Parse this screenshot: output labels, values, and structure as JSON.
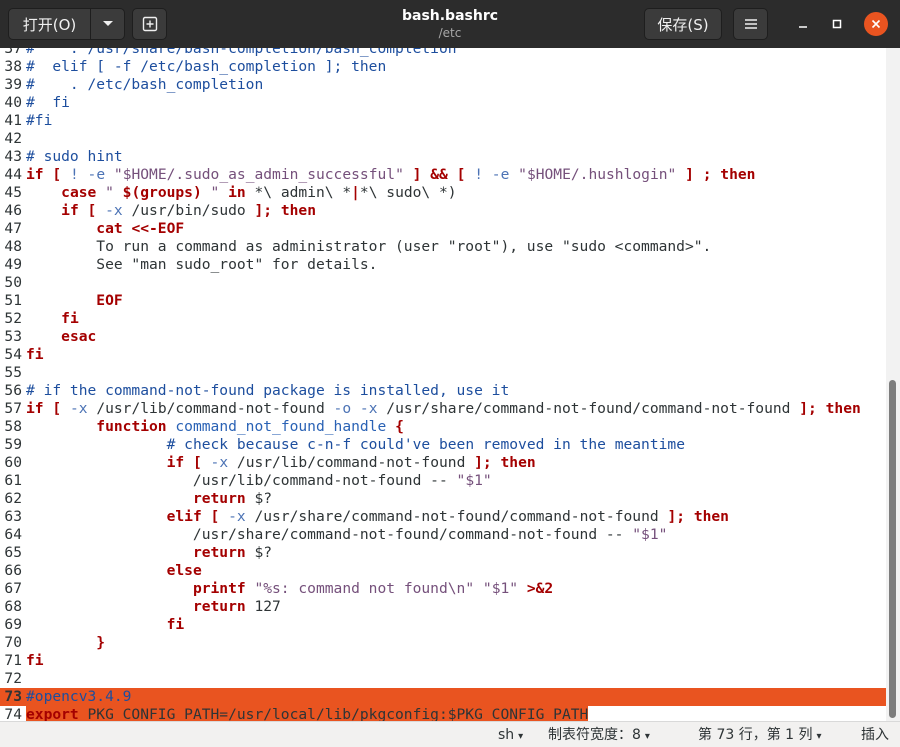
{
  "header": {
    "open_label": "打开(O)",
    "open_dropdown_icon": "chevron-down-icon",
    "new_tab_icon": "new-tab-icon",
    "title": "bash.bashrc",
    "subtitle": "/etc",
    "save_label": "保存(S)",
    "menu_icon": "hamburger-menu-icon",
    "window_controls": [
      "minimize-icon",
      "maximize-icon",
      "close-icon"
    ]
  },
  "editor": {
    "lines": [
      {
        "n": "37",
        "segs": [
          {
            "t": "#    . /usr/share/bash-completion/bash_completion",
            "c": "cmt"
          }
        ]
      },
      {
        "n": "38",
        "segs": [
          {
            "t": "#  elif [ -f /etc/bash_completion ]; then",
            "c": "cmt"
          }
        ]
      },
      {
        "n": "39",
        "segs": [
          {
            "t": "#    . /etc/bash_completion",
            "c": "cmt"
          }
        ]
      },
      {
        "n": "40",
        "segs": [
          {
            "t": "#  fi",
            "c": "cmt"
          }
        ]
      },
      {
        "n": "41",
        "segs": [
          {
            "t": "#fi",
            "c": "cmt"
          }
        ]
      },
      {
        "n": "42",
        "segs": []
      },
      {
        "n": "43",
        "segs": [
          {
            "t": "# sudo hint",
            "c": "cmt"
          }
        ]
      },
      {
        "n": "44",
        "segs": [
          {
            "t": "if",
            "c": "kw"
          },
          {
            "t": " ",
            "c": ""
          },
          {
            "t": "[",
            "c": "kw"
          },
          {
            "t": " ! -e ",
            "c": "opt"
          },
          {
            "t": "\"",
            "c": "str"
          },
          {
            "t": "$HOME",
            "c": "var"
          },
          {
            "t": "/.sudo_as_admin_successful\"",
            "c": "str"
          },
          {
            "t": " ",
            "c": ""
          },
          {
            "t": "]",
            "c": "kw"
          },
          {
            "t": " ",
            "c": ""
          },
          {
            "t": "&&",
            "c": "kw"
          },
          {
            "t": " ",
            "c": ""
          },
          {
            "t": "[",
            "c": "kw"
          },
          {
            "t": " ! -e ",
            "c": "opt"
          },
          {
            "t": "\"",
            "c": "str"
          },
          {
            "t": "$HOME",
            "c": "var"
          },
          {
            "t": "/.hushlogin\"",
            "c": "str"
          },
          {
            "t": " ",
            "c": ""
          },
          {
            "t": "]",
            "c": "kw"
          },
          {
            "t": " ",
            "c": ""
          },
          {
            "t": ";",
            "c": "kw"
          },
          {
            "t": " ",
            "c": ""
          },
          {
            "t": "then",
            "c": "kw"
          }
        ]
      },
      {
        "n": "45",
        "segs": [
          {
            "t": "    ",
            "c": ""
          },
          {
            "t": "case",
            "c": "kw"
          },
          {
            "t": " \" ",
            "c": "str"
          },
          {
            "t": "$(groups)",
            "c": "kw"
          },
          {
            "t": " \" ",
            "c": "str"
          },
          {
            "t": "in",
            "c": "kw"
          },
          {
            "t": " *\\ admin\\ *",
            "c": ""
          },
          {
            "t": "|",
            "c": "kw"
          },
          {
            "t": "*\\ sudo\\ *)",
            "c": ""
          }
        ]
      },
      {
        "n": "46",
        "segs": [
          {
            "t": "    ",
            "c": ""
          },
          {
            "t": "if",
            "c": "kw"
          },
          {
            "t": " ",
            "c": ""
          },
          {
            "t": "[",
            "c": "kw"
          },
          {
            "t": " -x",
            "c": "opt"
          },
          {
            "t": " /usr/bin/sudo ",
            "c": ""
          },
          {
            "t": "];",
            "c": "kw"
          },
          {
            "t": " ",
            "c": ""
          },
          {
            "t": "then",
            "c": "kw"
          }
        ]
      },
      {
        "n": "47",
        "segs": [
          {
            "t": "        ",
            "c": ""
          },
          {
            "t": "cat <<-EOF",
            "c": "kw"
          }
        ]
      },
      {
        "n": "48",
        "segs": [
          {
            "t": "        To run a command as administrator (user \"root\"), use \"sudo <command>\".",
            "c": ""
          }
        ]
      },
      {
        "n": "49",
        "segs": [
          {
            "t": "        See \"man sudo_root\" for details.",
            "c": ""
          }
        ]
      },
      {
        "n": "50",
        "segs": []
      },
      {
        "n": "51",
        "segs": [
          {
            "t": "        ",
            "c": ""
          },
          {
            "t": "EOF",
            "c": "kw"
          }
        ]
      },
      {
        "n": "52",
        "segs": [
          {
            "t": "    ",
            "c": ""
          },
          {
            "t": "fi",
            "c": "kw"
          }
        ]
      },
      {
        "n": "53",
        "segs": [
          {
            "t": "    ",
            "c": ""
          },
          {
            "t": "esac",
            "c": "kw"
          }
        ]
      },
      {
        "n": "54",
        "segs": [
          {
            "t": "fi",
            "c": "kw"
          }
        ]
      },
      {
        "n": "55",
        "segs": []
      },
      {
        "n": "56",
        "segs": [
          {
            "t": "# if the command-not-found package is installed, use it",
            "c": "cmt"
          }
        ]
      },
      {
        "n": "57",
        "segs": [
          {
            "t": "if",
            "c": "kw"
          },
          {
            "t": " ",
            "c": ""
          },
          {
            "t": "[",
            "c": "kw"
          },
          {
            "t": " -x",
            "c": "opt"
          },
          {
            "t": " /usr/lib/command-not-found ",
            "c": ""
          },
          {
            "t": "-o",
            "c": "opt"
          },
          {
            "t": " ",
            "c": ""
          },
          {
            "t": "-x",
            "c": "opt"
          },
          {
            "t": " /usr/share/command-not-found/command-not-found ",
            "c": ""
          },
          {
            "t": "];",
            "c": "kw"
          },
          {
            "t": " ",
            "c": ""
          },
          {
            "t": "then",
            "c": "kw"
          }
        ]
      },
      {
        "n": "58",
        "segs": [
          {
            "t": "        ",
            "c": ""
          },
          {
            "t": "function",
            "c": "kw"
          },
          {
            "t": " ",
            "c": ""
          },
          {
            "t": "command_not_found_handle",
            "c": "fn"
          },
          {
            "t": " ",
            "c": ""
          },
          {
            "t": "{",
            "c": "kw"
          }
        ]
      },
      {
        "n": "59",
        "segs": [
          {
            "t": "                ",
            "c": ""
          },
          {
            "t": "# check because c-n-f could've been removed in the meantime",
            "c": "cmt"
          }
        ]
      },
      {
        "n": "60",
        "segs": [
          {
            "t": "                ",
            "c": ""
          },
          {
            "t": "if",
            "c": "kw"
          },
          {
            "t": " ",
            "c": ""
          },
          {
            "t": "[",
            "c": "kw"
          },
          {
            "t": " -x",
            "c": "opt"
          },
          {
            "t": " /usr/lib/command-not-found ",
            "c": ""
          },
          {
            "t": "];",
            "c": "kw"
          },
          {
            "t": " ",
            "c": ""
          },
          {
            "t": "then",
            "c": "kw"
          }
        ]
      },
      {
        "n": "61",
        "segs": [
          {
            "t": "                   /usr/lib/command-not-found -- ",
            "c": ""
          },
          {
            "t": "\"$1\"",
            "c": "str"
          }
        ]
      },
      {
        "n": "62",
        "segs": [
          {
            "t": "                   ",
            "c": ""
          },
          {
            "t": "return",
            "c": "kw"
          },
          {
            "t": " $?",
            "c": ""
          }
        ]
      },
      {
        "n": "63",
        "segs": [
          {
            "t": "                ",
            "c": ""
          },
          {
            "t": "elif",
            "c": "kw"
          },
          {
            "t": " ",
            "c": ""
          },
          {
            "t": "[",
            "c": "kw"
          },
          {
            "t": " -x",
            "c": "opt"
          },
          {
            "t": " /usr/share/command-not-found/command-not-found ",
            "c": ""
          },
          {
            "t": "];",
            "c": "kw"
          },
          {
            "t": " ",
            "c": ""
          },
          {
            "t": "then",
            "c": "kw"
          }
        ]
      },
      {
        "n": "64",
        "segs": [
          {
            "t": "                   /usr/share/command-not-found/command-not-found -- ",
            "c": ""
          },
          {
            "t": "\"$1\"",
            "c": "str"
          }
        ]
      },
      {
        "n": "65",
        "segs": [
          {
            "t": "                   ",
            "c": ""
          },
          {
            "t": "return",
            "c": "kw"
          },
          {
            "t": " $?",
            "c": ""
          }
        ]
      },
      {
        "n": "66",
        "segs": [
          {
            "t": "                ",
            "c": ""
          },
          {
            "t": "else",
            "c": "kw"
          }
        ]
      },
      {
        "n": "67",
        "segs": [
          {
            "t": "                   ",
            "c": ""
          },
          {
            "t": "printf",
            "c": "kw"
          },
          {
            "t": " ",
            "c": ""
          },
          {
            "t": "\"%s: command not found\\n\"",
            "c": "str"
          },
          {
            "t": " ",
            "c": ""
          },
          {
            "t": "\"$1\"",
            "c": "str"
          },
          {
            "t": " ",
            "c": ""
          },
          {
            "t": ">&2",
            "c": "kw"
          }
        ]
      },
      {
        "n": "68",
        "segs": [
          {
            "t": "                   ",
            "c": ""
          },
          {
            "t": "return",
            "c": "kw"
          },
          {
            "t": " 127",
            "c": ""
          }
        ]
      },
      {
        "n": "69",
        "segs": [
          {
            "t": "                ",
            "c": ""
          },
          {
            "t": "fi",
            "c": "kw"
          }
        ]
      },
      {
        "n": "70",
        "segs": [
          {
            "t": "        ",
            "c": ""
          },
          {
            "t": "}",
            "c": "kw"
          }
        ]
      },
      {
        "n": "71",
        "segs": [
          {
            "t": "fi",
            "c": "kw"
          }
        ]
      },
      {
        "n": "72",
        "segs": []
      },
      {
        "n": "73",
        "hl": true,
        "segs": [
          {
            "t": "#opencv3.4.9",
            "c": "cmt"
          }
        ]
      },
      {
        "n": "74",
        "segs": [
          {
            "t": "export",
            "c": "kw"
          },
          {
            "t": " PKG_CONFIG_PATH=/usr/local/lib/pkgconfig:$PKG_CONFIG_PATH",
            "c": ""
          }
        ],
        "sel": true
      }
    ]
  },
  "statusbar": {
    "language": "sh",
    "tab_width": "制表符宽度：8",
    "position": "第 73 行，第 1 列",
    "mode": "插入"
  },
  "colors": {
    "header_bg": "#2c2c2c",
    "accent": "#e95420",
    "keyword": "#a40000",
    "comment": "#1d4e9e",
    "string": "#75507b"
  }
}
